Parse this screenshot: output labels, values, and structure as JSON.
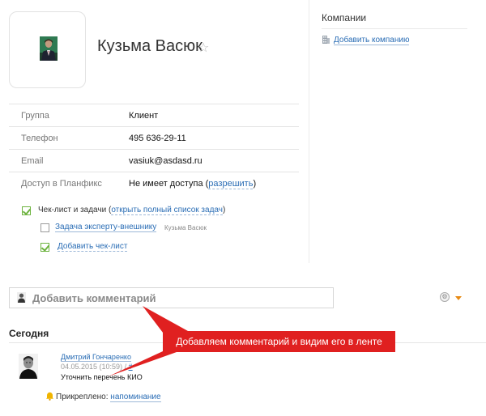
{
  "contact": {
    "name": "Кузьма Васюк",
    "favorite_icon": "star-icon"
  },
  "properties": [
    {
      "label": "Группа",
      "value": "Клиент"
    },
    {
      "label": "Телефон",
      "value": "495 636-29-11"
    },
    {
      "label": "Email",
      "value": "vasiuk@asdasd.ru"
    },
    {
      "label": "Доступ в Планфикс",
      "value": "Не имеет доступа",
      "link_prefix": " (",
      "link": "разрешить",
      "link_suffix": ")"
    }
  ],
  "companies": {
    "title": "Компании",
    "add_link": "Добавить компанию",
    "icon": "building-icon"
  },
  "checklist": {
    "title": "Чек-лист и задачи",
    "full_list_prefix": " (",
    "full_list_link": "открыть полный список задач",
    "full_list_suffix": ")",
    "task_label": "Задача эксперту-внешнику",
    "task_assignee": "Кузьма Васюк",
    "add_link": "Добавить чек-лист"
  },
  "comment": {
    "placeholder": "Добавить комментарий"
  },
  "feed": {
    "section_title": "Сегодня",
    "author": "Дмитрий Гончаренко",
    "timestamp": "04.05.2015 (10:59)",
    "separator": "/",
    "hash": "#",
    "text": "Уточнить перечень КИО",
    "attached_label": "Прикреплено:",
    "attached_link": "напоминание"
  },
  "callout": {
    "text": "Добавляем комментарий и видим его в ленте",
    "color": "#e02020"
  }
}
